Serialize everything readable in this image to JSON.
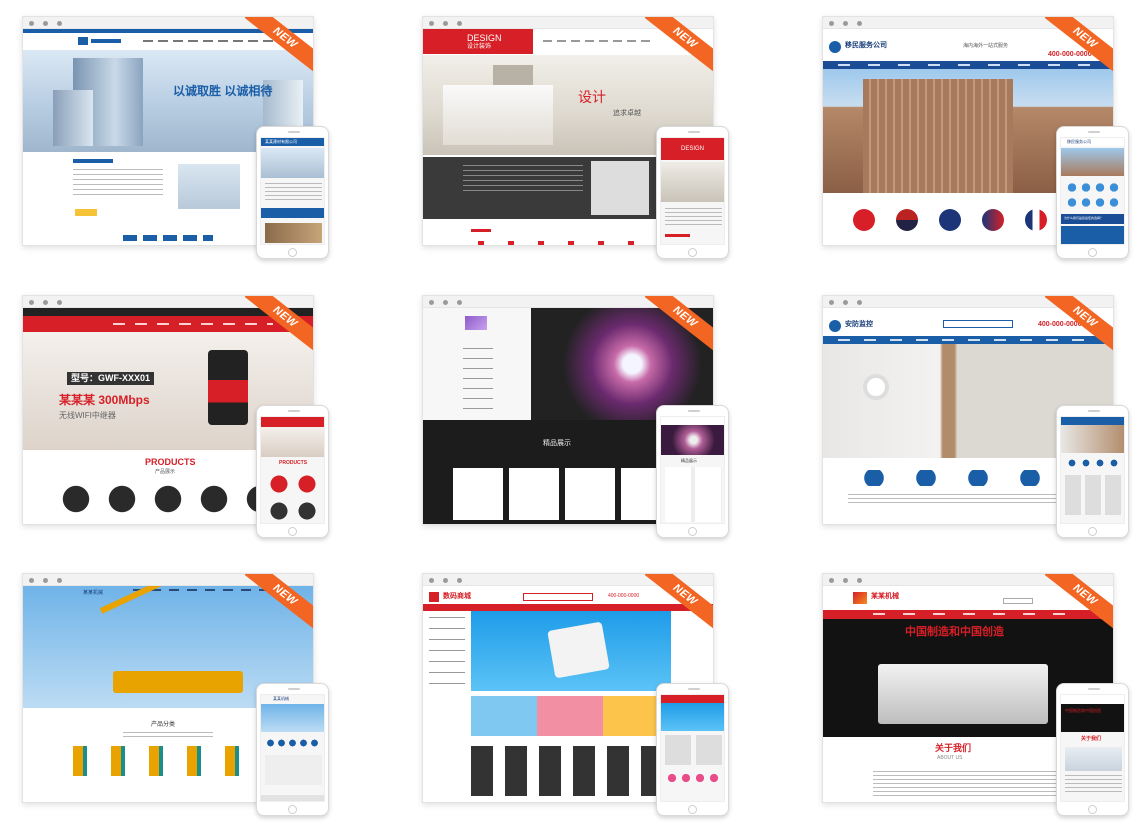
{
  "badge_label": "NEW",
  "colors": {
    "ribbon": "#f26522",
    "blue_nav": "#1a5ea8",
    "red_brand": "#d61f26"
  },
  "templates": [
    {
      "id": "t1",
      "slogan": "以诚取胜 以诚相待",
      "phone_title": "某某建材有限公司"
    },
    {
      "id": "t2",
      "brand": "DESIGN",
      "brand_cn": "设计装饰",
      "hero_text_1": "设计",
      "hero_text_2": "追求卓越",
      "phone_brand": "DESIGN"
    },
    {
      "id": "t3",
      "company": "移民服务公司",
      "slogan": "海内海外一站式服务",
      "phone": "400-000-0000",
      "phone_company": "移民服务公司",
      "phone_banner": "为什么我们是您最佳的选择？"
    },
    {
      "id": "t4",
      "model": "型号：GWF-XXX01",
      "product_line": "某某某 300Mbps",
      "product_sub": "无线WIFI中继器",
      "section_en": "PRODUCTS",
      "section_cn": "产品展示",
      "phone_section": "PRODUCTS"
    },
    {
      "id": "t5",
      "section": "精品展示",
      "phone_label": "精品展示"
    },
    {
      "id": "t6",
      "brand": "安防监控",
      "phone": "400-000-0000"
    },
    {
      "id": "t7",
      "brand": "某某机械",
      "section": "产品分类",
      "phone_brand": "某某机械"
    },
    {
      "id": "t8",
      "brand": "数码商城",
      "hotline": "400-000-0000"
    },
    {
      "id": "t9",
      "brand": "某某机械",
      "hero": "中国制造和中国创造",
      "about": "关于我们",
      "about_en": "ABOUT US",
      "phone_hero": "中国制造和中国创造",
      "phone_about": "关于我们"
    }
  ]
}
